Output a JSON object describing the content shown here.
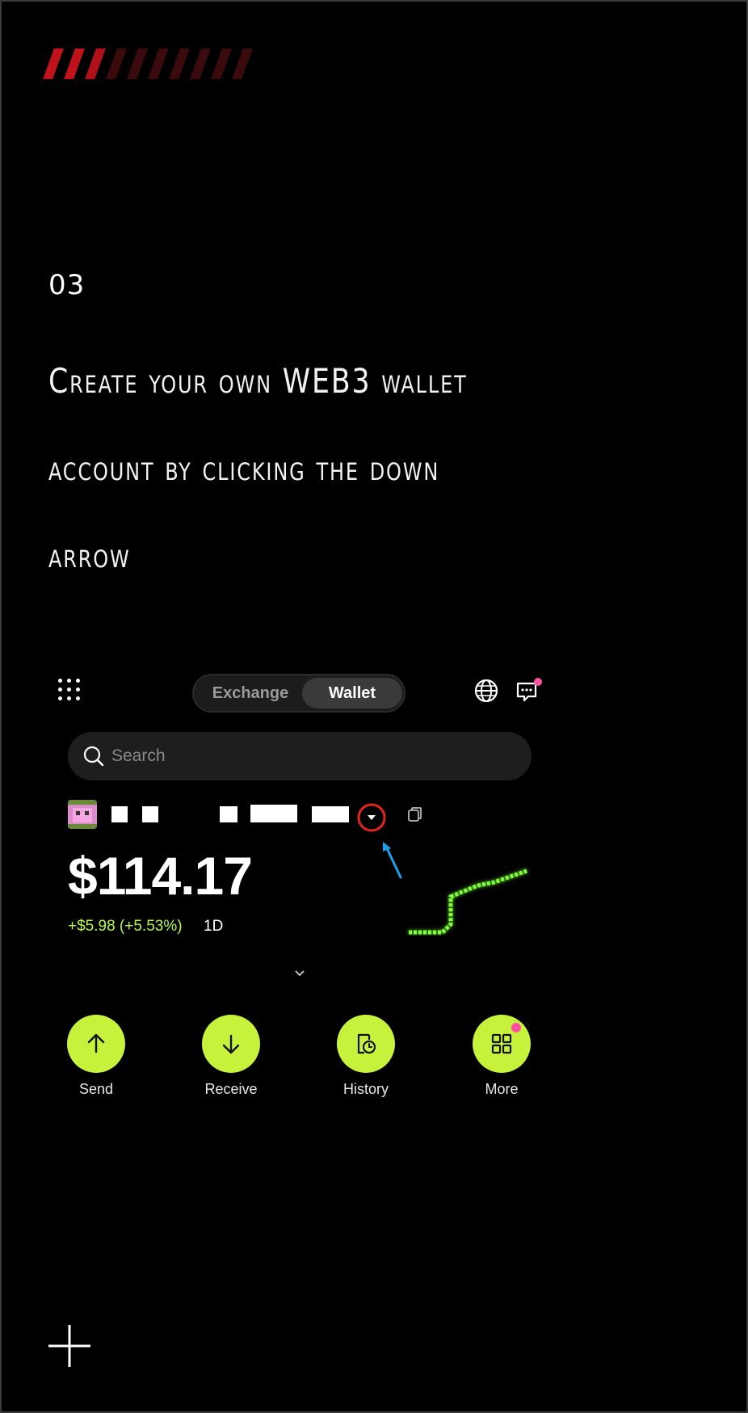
{
  "step": {
    "number": "03"
  },
  "headline": {
    "lines": [
      "Create your own WEB3 wallet",
      "account by clicking the down",
      "arrow"
    ]
  },
  "wallet_ui": {
    "tabs": {
      "exchange": "Exchange",
      "wallet": "Wallet",
      "active": "Wallet"
    },
    "search": {
      "placeholder": "Search"
    },
    "balance": "$114.17",
    "change": "+$5.98 (+5.53%)",
    "period": "1D",
    "actions": [
      {
        "label": "Send",
        "icon": "arrow-up-icon"
      },
      {
        "label": "Receive",
        "icon": "arrow-down-icon"
      },
      {
        "label": "History",
        "icon": "history-icon"
      },
      {
        "label": "More",
        "icon": "grid-icon"
      }
    ]
  },
  "colors": {
    "background": "#000000",
    "accent": "#c7f23c",
    "change_positive": "#b6f94a",
    "badge": "#ff4fa0",
    "annotation_circle": "#e0261b",
    "annotation_arrow": "#1ea0e6",
    "stripe_bright": "#c0121a",
    "stripe_dim": "#3a0a0c"
  }
}
